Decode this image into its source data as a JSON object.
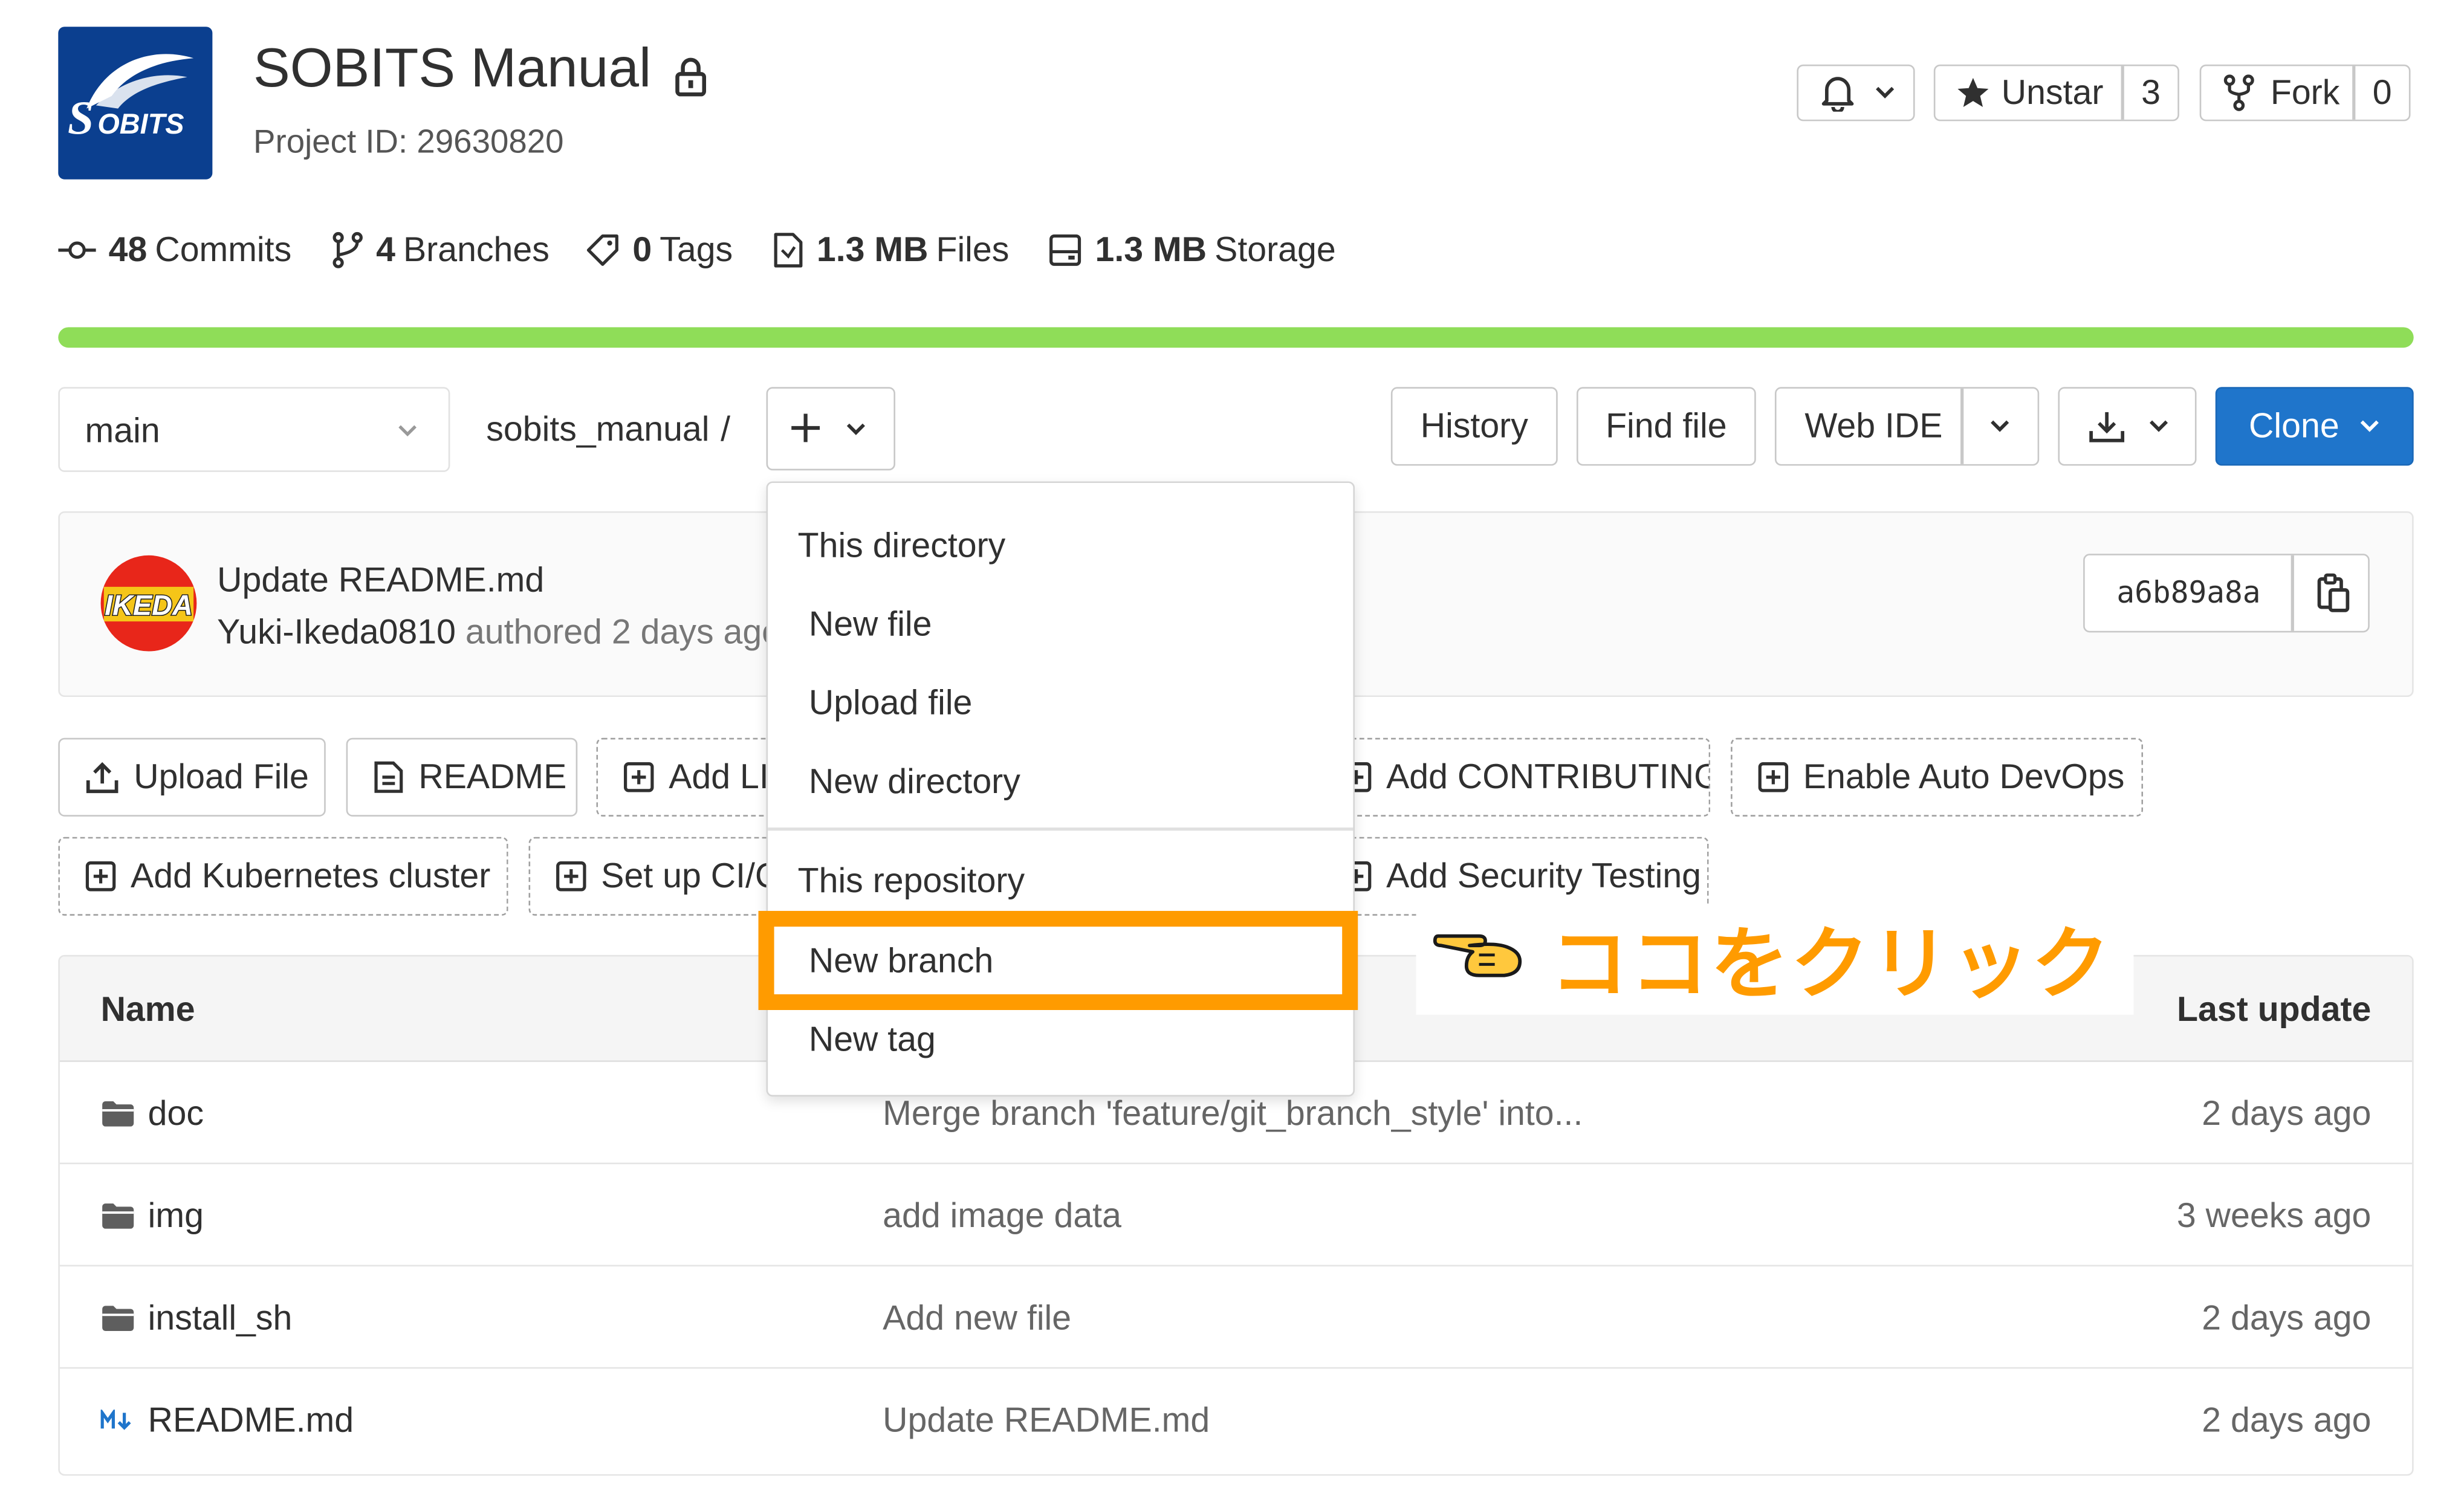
{
  "project": {
    "title": "SOBITS Manual",
    "id_text": "Project ID: 29630820",
    "logo_text": "OBITS"
  },
  "header_actions": {
    "unstar_label": "Unstar",
    "star_count": "3",
    "fork_label": "Fork",
    "fork_count": "0"
  },
  "stats": [
    {
      "value": "48",
      "label": "Commits",
      "icon": "commit-icon"
    },
    {
      "value": "4",
      "label": "Branches",
      "icon": "branch-icon"
    },
    {
      "value": "0",
      "label": "Tags",
      "icon": "tag-icon"
    },
    {
      "value": "1.3 MB",
      "label": "Files",
      "icon": "file-icon"
    },
    {
      "value": "1.3 MB",
      "label": "Storage",
      "icon": "storage-icon"
    }
  ],
  "storage_bar_color": "#8fdd58",
  "toolbar": {
    "branch": "main",
    "path": "sobits_manual",
    "path_sep": "/",
    "history": "History",
    "find_file": "Find file",
    "web_ide": "Web IDE",
    "clone": "Clone"
  },
  "last_commit": {
    "avatar_text": "IKEDA",
    "title": "Update README.md",
    "author": "Yuki-Ikeda0810",
    "meta": "authored 2 days ago",
    "sha": "a6b89a8a"
  },
  "suggestions": {
    "row1": [
      "Upload File",
      "README",
      "Add LICENSE",
      "Add CONTRIBUTING",
      "Enable Auto DevOps"
    ],
    "row2": [
      "Add Kubernetes cluster",
      "Set up CI/CD",
      "Add Security Testing"
    ]
  },
  "table": {
    "col_name": "Name",
    "col_update": "Last update",
    "rows": [
      {
        "name": "doc",
        "message": "Merge branch 'feature/git_branch_style' into...",
        "date": "2 days ago",
        "icon": "folder-icon"
      },
      {
        "name": "img",
        "message": "add image data",
        "date": "3 weeks ago",
        "icon": "folder-icon"
      },
      {
        "name": "install_sh",
        "message": "Add new file",
        "date": "2 days ago",
        "icon": "folder-icon"
      },
      {
        "name": "README.md",
        "message": "Update README.md",
        "date": "2 days ago",
        "icon": "markdown-icon"
      }
    ]
  },
  "dropdown": {
    "dir_header": "This directory",
    "dir_items": [
      "New file",
      "Upload file",
      "New directory"
    ],
    "repo_header": "This repository",
    "repo_items": [
      "New branch",
      "New tag"
    ]
  },
  "annotation": {
    "text": "ココをクリック",
    "color": "#ff9b00"
  },
  "accent_color": "#1f75cb"
}
